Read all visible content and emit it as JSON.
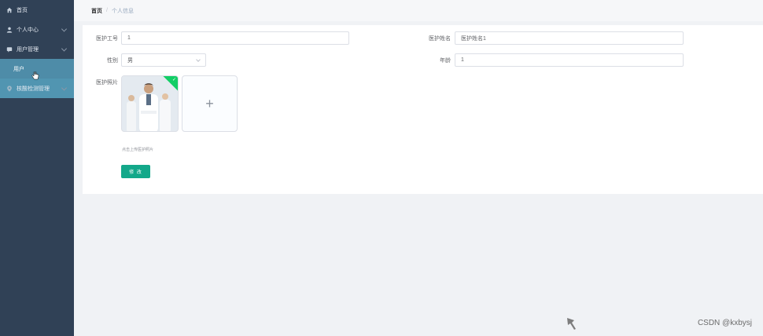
{
  "sidebar": {
    "items": [
      {
        "label": "首页",
        "icon": "home-icon"
      },
      {
        "label": "个人中心",
        "icon": "user-icon"
      },
      {
        "label": "用户管理",
        "icon": "message-icon"
      },
      {
        "label": "用户",
        "icon": ""
      },
      {
        "label": "核酸检测管理",
        "icon": "location-icon"
      }
    ]
  },
  "breadcrumb": {
    "home": "首页",
    "separator": "/",
    "current": "个人信息"
  },
  "form": {
    "staff_id_label": "医护工号",
    "staff_id_value": "1",
    "staff_name_label": "医护姓名",
    "staff_name_value": "医护姓名1",
    "gender_label": "性别",
    "gender_value": "男",
    "age_label": "年龄",
    "age_value": "1",
    "photo_label": "医护照片",
    "upload_plus": "+",
    "upload_tip": "点击上传医护照片",
    "submit_label": "修 改"
  },
  "watermark": "CSDN @kxbysj",
  "colors": {
    "sidebar_bg": "#304156",
    "active_bg": "#4e8ca8",
    "primary_button": "#13a88a",
    "success_corner": "#13ce66"
  }
}
